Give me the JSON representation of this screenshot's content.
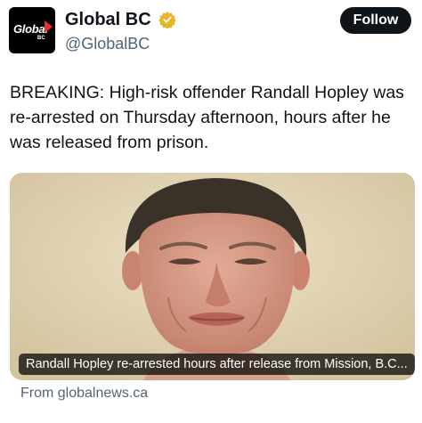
{
  "account": {
    "display_name": "Global BC",
    "handle": "@GlobalBC",
    "avatar_text": "Global",
    "avatar_subtext": "BC",
    "verified_color": "#e8b52a"
  },
  "follow_label": "Follow",
  "tweet": {
    "text": "BREAKING: High-risk offender Randall Hopley was re-arrested on Thursday afternoon, hours after he was released from prison."
  },
  "card": {
    "caption": "Randall Hopley re-arrested hours after release from Mission, B.C...",
    "source": "From globalnews.ca"
  },
  "colors": {
    "text_primary": "#0f1419",
    "text_secondary": "#536471",
    "follow_bg": "#0f1419",
    "brand_red": "#e8312f"
  }
}
